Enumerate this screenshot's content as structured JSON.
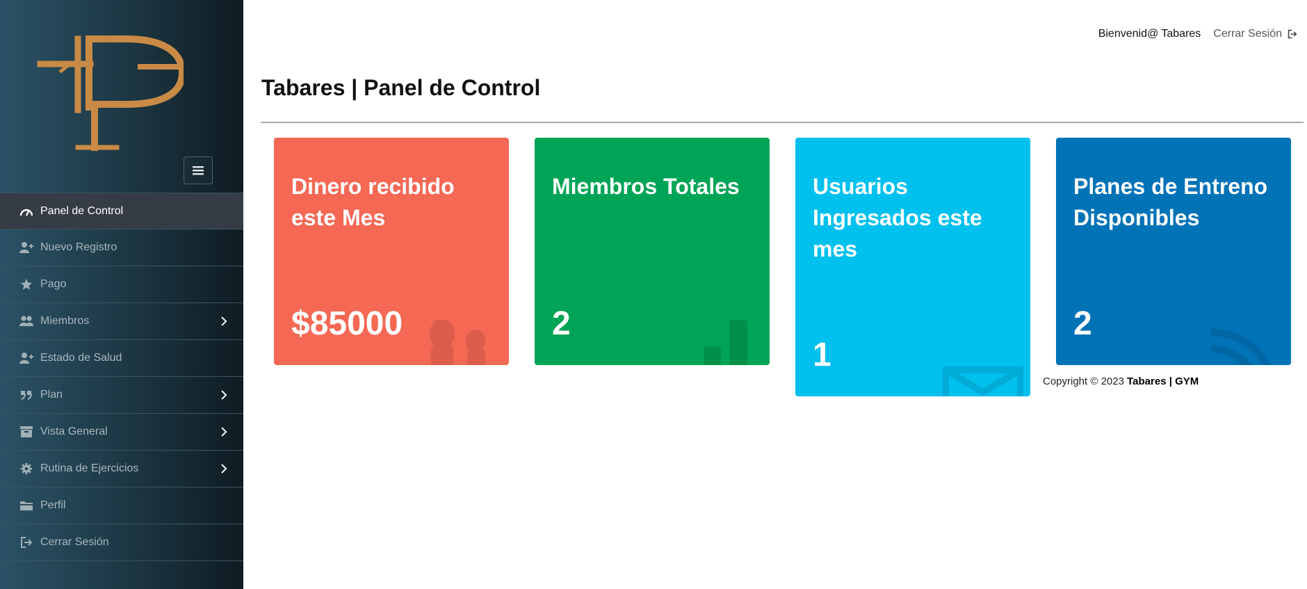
{
  "sidebar": {
    "menu": [
      {
        "label": "Panel de Control",
        "icon": "dashboard-icon",
        "active": true
      },
      {
        "label": "Nuevo Registro",
        "icon": "user-plus-icon"
      },
      {
        "label": "Pago",
        "icon": "star-icon"
      },
      {
        "label": "Miembros",
        "icon": "users-icon",
        "has_submenu": true
      },
      {
        "label": "Estado de Salud",
        "icon": "user-plus-icon"
      },
      {
        "label": "Plan",
        "icon": "quote-icon",
        "has_submenu": true
      },
      {
        "label": "Vista General",
        "icon": "archive-icon",
        "has_submenu": true
      },
      {
        "label": "Rutina de Ejercicios",
        "icon": "gear-icon",
        "has_submenu": true
      },
      {
        "label": "Perfil",
        "icon": "folder-icon"
      },
      {
        "label": "Cerrar Sesión",
        "icon": "sign-out-icon"
      }
    ]
  },
  "header": {
    "welcome": "Bienvenid@ Tabares",
    "logout": "Cerrar Sesión"
  },
  "page_title": "Tabares | Panel de Control",
  "cards": [
    {
      "title": "Dinero recibido este Mes",
      "value": "$85000",
      "color": "#f46854",
      "icon": "users-icon"
    },
    {
      "title": "Miembros Totales",
      "value": "2",
      "color": "#00a456",
      "icon": "bar-chart-icon"
    },
    {
      "title": "Usuarios Ingresados este mes",
      "value": "1",
      "color": "#00c0ee",
      "icon": "envelope-icon"
    },
    {
      "title": "Planes de Entreno Disponibles",
      "value": "2",
      "color": "#0073b7",
      "icon": "rss-icon"
    }
  ],
  "footer": {
    "copyright": "Copyright © 2023 ",
    "brand": "Tabares | GYM"
  }
}
